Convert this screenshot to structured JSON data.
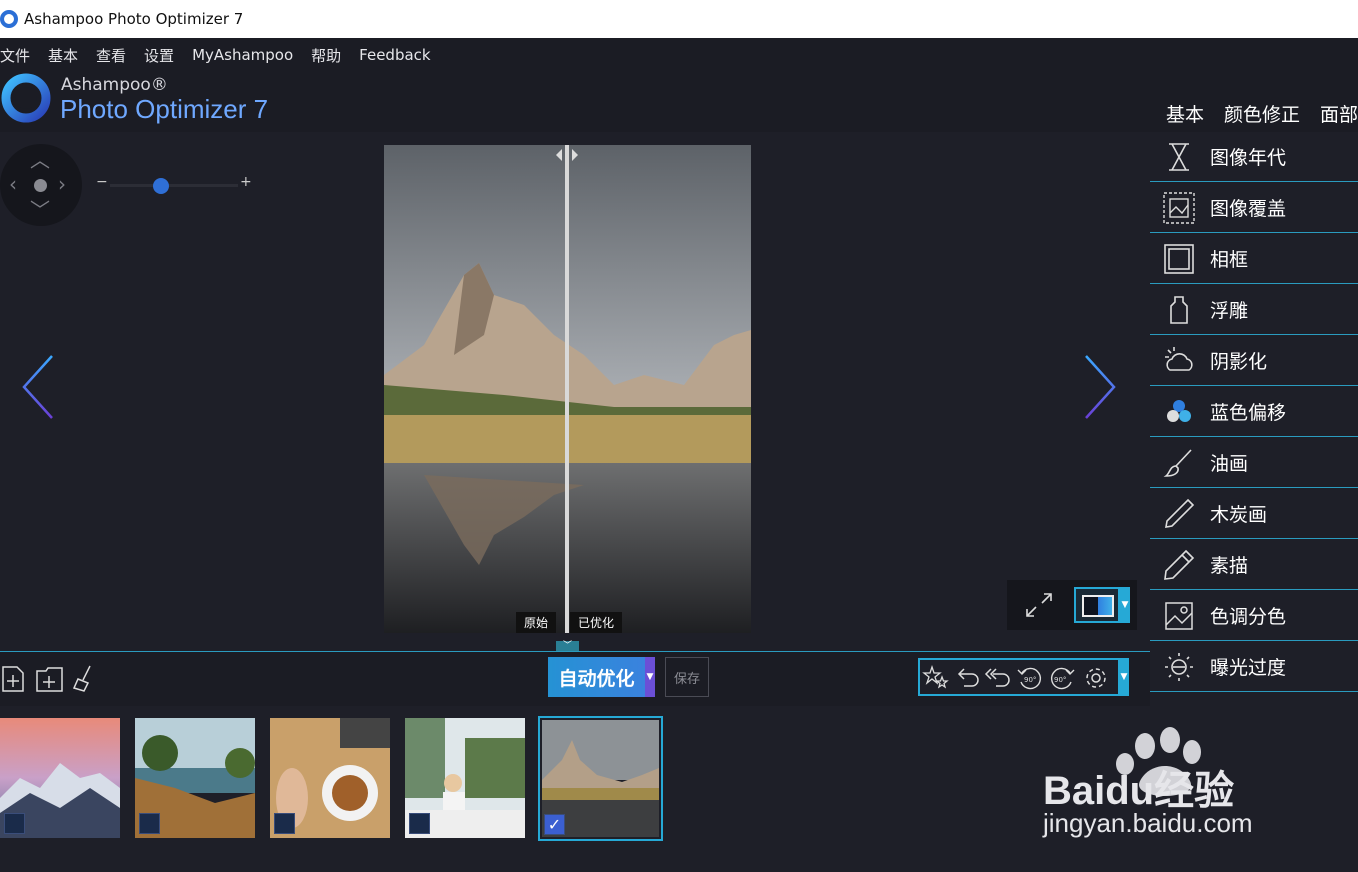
{
  "window": {
    "title": "Ashampoo Photo Optimizer 7"
  },
  "menu": [
    "文件",
    "基本",
    "查看",
    "设置",
    "MyAshampoo",
    "帮助",
    "Feedback"
  ],
  "header": {
    "brand": "Ashampoo®",
    "product": "Photo Optimizer 7",
    "tabs": [
      "基本",
      "颜色修正",
      "面部"
    ]
  },
  "viewer": {
    "zoom_minus": "−",
    "zoom_plus": "+",
    "zoom_level": 0.4,
    "compare_labels": {
      "original": "原始",
      "optimized": "已优化"
    }
  },
  "toolbar": {
    "auto_optimize": "自动优化",
    "save": "保存"
  },
  "effects": [
    {
      "label": "图像年代",
      "icon": "hourglass-icon"
    },
    {
      "label": "图像覆盖",
      "icon": "image-overlay-icon"
    },
    {
      "label": "相框",
      "icon": "frame-icon"
    },
    {
      "label": "浮雕",
      "icon": "emboss-icon"
    },
    {
      "label": "阴影化",
      "icon": "shadow-cloud-icon"
    },
    {
      "label": "蓝色偏移",
      "icon": "blue-shift-icon"
    },
    {
      "label": "油画",
      "icon": "oil-brush-icon"
    },
    {
      "label": "木炭画",
      "icon": "charcoal-icon"
    },
    {
      "label": "素描",
      "icon": "pencil-icon"
    },
    {
      "label": "色调分色",
      "icon": "posterize-icon"
    },
    {
      "label": "曝光过度",
      "icon": "overexposure-icon"
    }
  ],
  "filmstrip": [
    {
      "name": "snowy-mountains",
      "checked": false
    },
    {
      "name": "coast-sunset",
      "checked": false
    },
    {
      "name": "breakfast-table",
      "checked": false
    },
    {
      "name": "woman-laptop",
      "checked": false
    },
    {
      "name": "mountain-lake",
      "checked": true
    }
  ],
  "watermark": {
    "brand": "Baidu经验",
    "url": "jingyan.baidu.com"
  },
  "colors": {
    "accent": "#26a9d6",
    "bg": "#1e1f28",
    "bar": "#1b1c24"
  }
}
